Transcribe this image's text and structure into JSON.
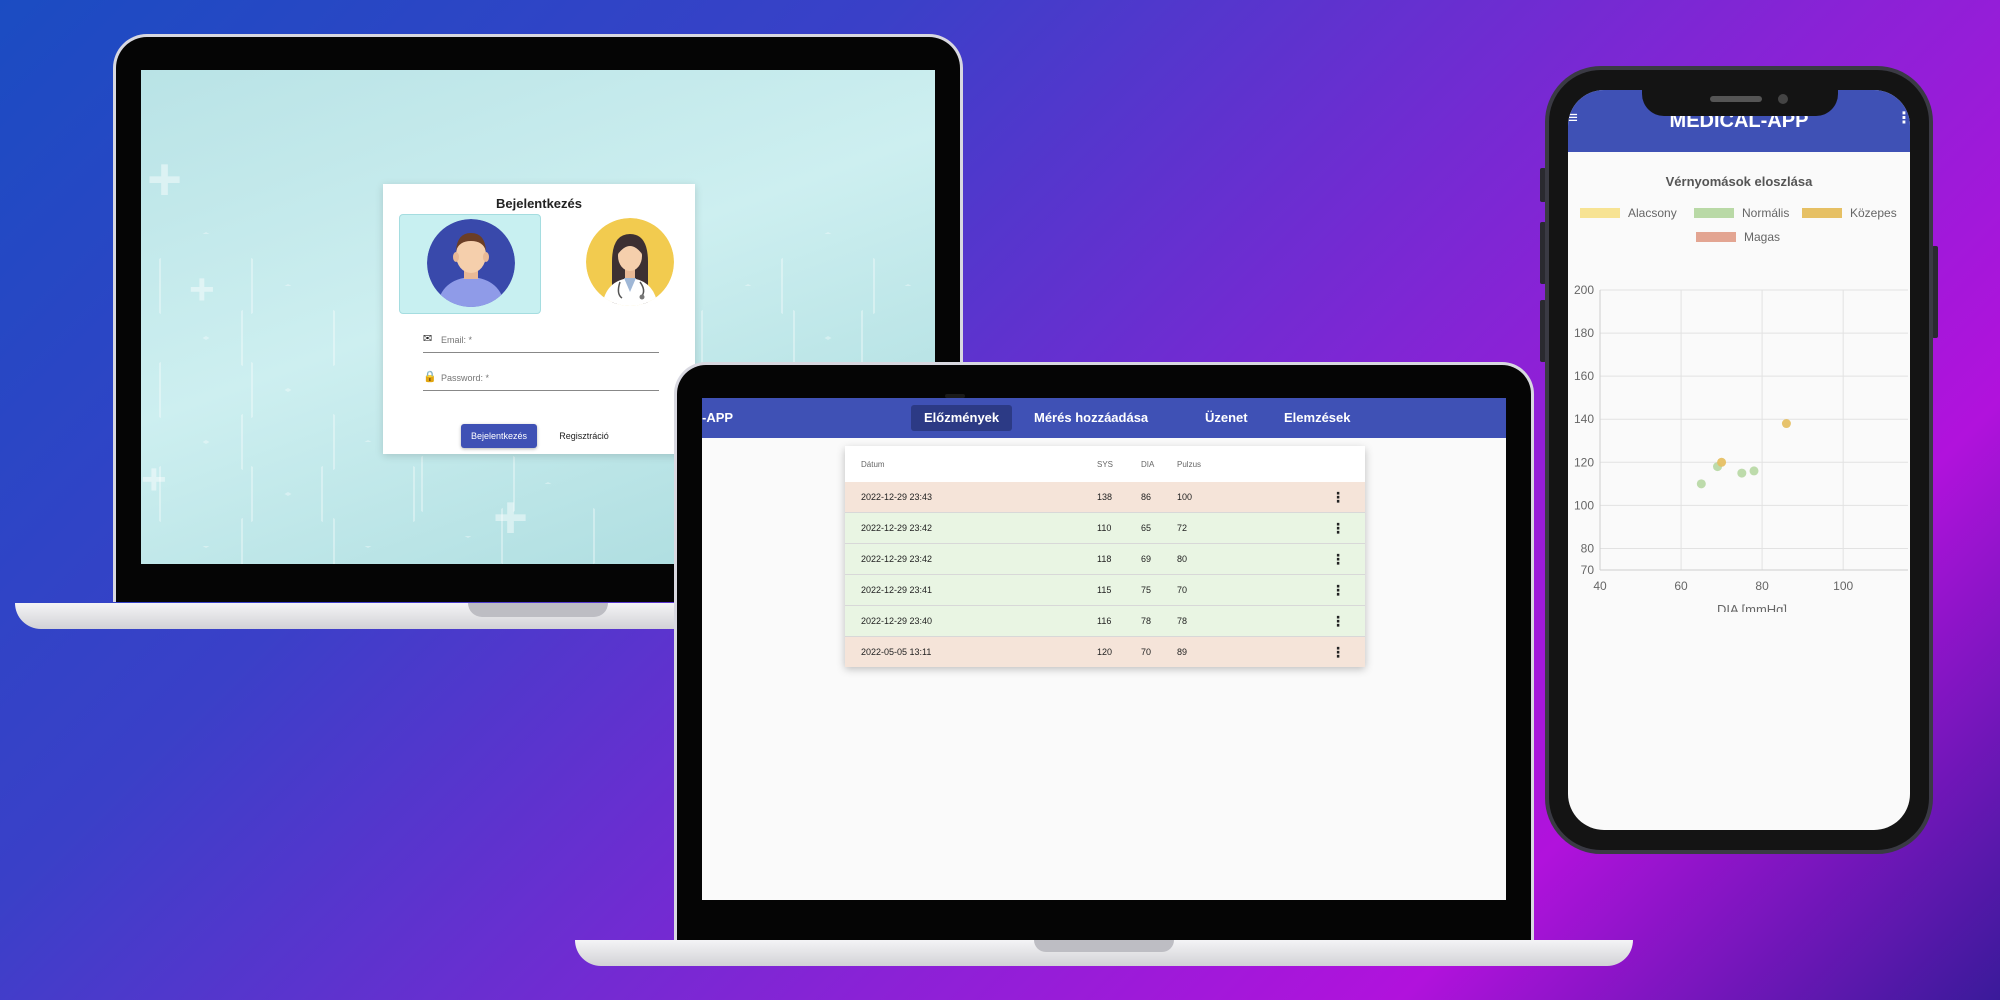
{
  "login": {
    "title": "Bejelentkezés",
    "email_placeholder": "Email: *",
    "password_placeholder": "Password: *",
    "login_button": "Bejelentkezés",
    "register_button": "Regisztráció"
  },
  "app": {
    "brand_fragment": "-APP",
    "tabs": [
      {
        "label": "Előzmények",
        "active": true
      },
      {
        "label": "Mérés hozzáadása"
      },
      {
        "label": "Üzenet"
      },
      {
        "label": "Elemzések"
      }
    ]
  },
  "history_table": {
    "headers": [
      "Dátum",
      "SYS",
      "DIA",
      "Pulzus"
    ],
    "rows": [
      {
        "date": "2022-12-29 23:43",
        "sys": "138",
        "dia": "86",
        "pulse": "100",
        "status": "high"
      },
      {
        "date": "2022-12-29 23:42",
        "sys": "110",
        "dia": "65",
        "pulse": "72",
        "status": "normal"
      },
      {
        "date": "2022-12-29 23:42",
        "sys": "118",
        "dia": "69",
        "pulse": "80",
        "status": "normal"
      },
      {
        "date": "2022-12-29 23:41",
        "sys": "115",
        "dia": "75",
        "pulse": "70",
        "status": "normal"
      },
      {
        "date": "2022-12-29 23:40",
        "sys": "116",
        "dia": "78",
        "pulse": "78",
        "status": "normal"
      },
      {
        "date": "2022-05-05 13:11",
        "sys": "120",
        "dia": "70",
        "pulse": "89",
        "status": "high"
      }
    ],
    "row_menu_icon": "more-vert-icon"
  },
  "phone": {
    "title": "MEDICAL-APP",
    "menu_icon": "≡",
    "more_icon": "⋮"
  },
  "colors": {
    "primary": "#3f51b5",
    "primary_dark": "#2c3a85",
    "row_high": "#f5e4d9",
    "row_normal": "#e9f5e3"
  },
  "chart_data": {
    "type": "scatter",
    "title": "Vérnyomások eloszlása",
    "xlabel": "DIA [mmHg]",
    "ylabel": "",
    "xlim": [
      40,
      116
    ],
    "ylim": [
      70,
      200
    ],
    "x_ticks": [
      40,
      60,
      80,
      100
    ],
    "y_ticks": [
      70,
      80,
      100,
      120,
      140,
      160,
      180,
      200
    ],
    "grid": true,
    "legend_position": "top",
    "series": [
      {
        "name": "Alacsony",
        "color": "#f7e393",
        "points": []
      },
      {
        "name": "Normális",
        "color": "#b9d9a6",
        "points": [
          [
            65,
            110
          ],
          [
            69,
            118
          ],
          [
            75,
            115
          ],
          [
            78,
            116
          ]
        ]
      },
      {
        "name": "Közepes",
        "color": "#e6c064",
        "points": [
          [
            70,
            120
          ],
          [
            86,
            138
          ]
        ]
      },
      {
        "name": "Magas",
        "color": "#e3a592",
        "points": []
      }
    ]
  }
}
